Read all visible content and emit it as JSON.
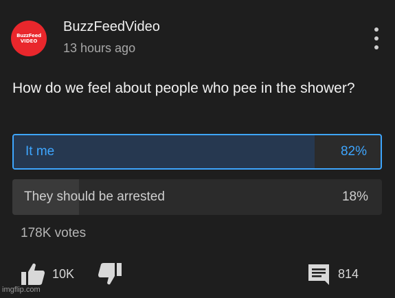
{
  "channel": {
    "avatar_line1": "BuzzFeed",
    "avatar_line2": "VIDEO",
    "name": "BuzzFeedVideo",
    "timestamp": "13 hours ago"
  },
  "post": {
    "question": "How do we feel about people who pee in the shower?",
    "poll": {
      "options": [
        {
          "label": "It me",
          "percent_text": "82%",
          "fraction": 0.82,
          "selected": true
        },
        {
          "label": "They should be arrested",
          "percent_text": "18%",
          "fraction": 0.18,
          "selected": false
        }
      ],
      "votes": "178K votes"
    }
  },
  "actions": {
    "likes": "10K",
    "comments": "814"
  },
  "icons": {
    "menu": "more-vertical-icon",
    "like": "thumbs-up-icon",
    "dislike": "thumbs-down-icon",
    "comment": "comment-icon"
  },
  "colors": {
    "accent": "#3ea6ff",
    "selected_fill": "#263850",
    "brand": "#e9272c"
  },
  "watermark": "imgflip.com"
}
